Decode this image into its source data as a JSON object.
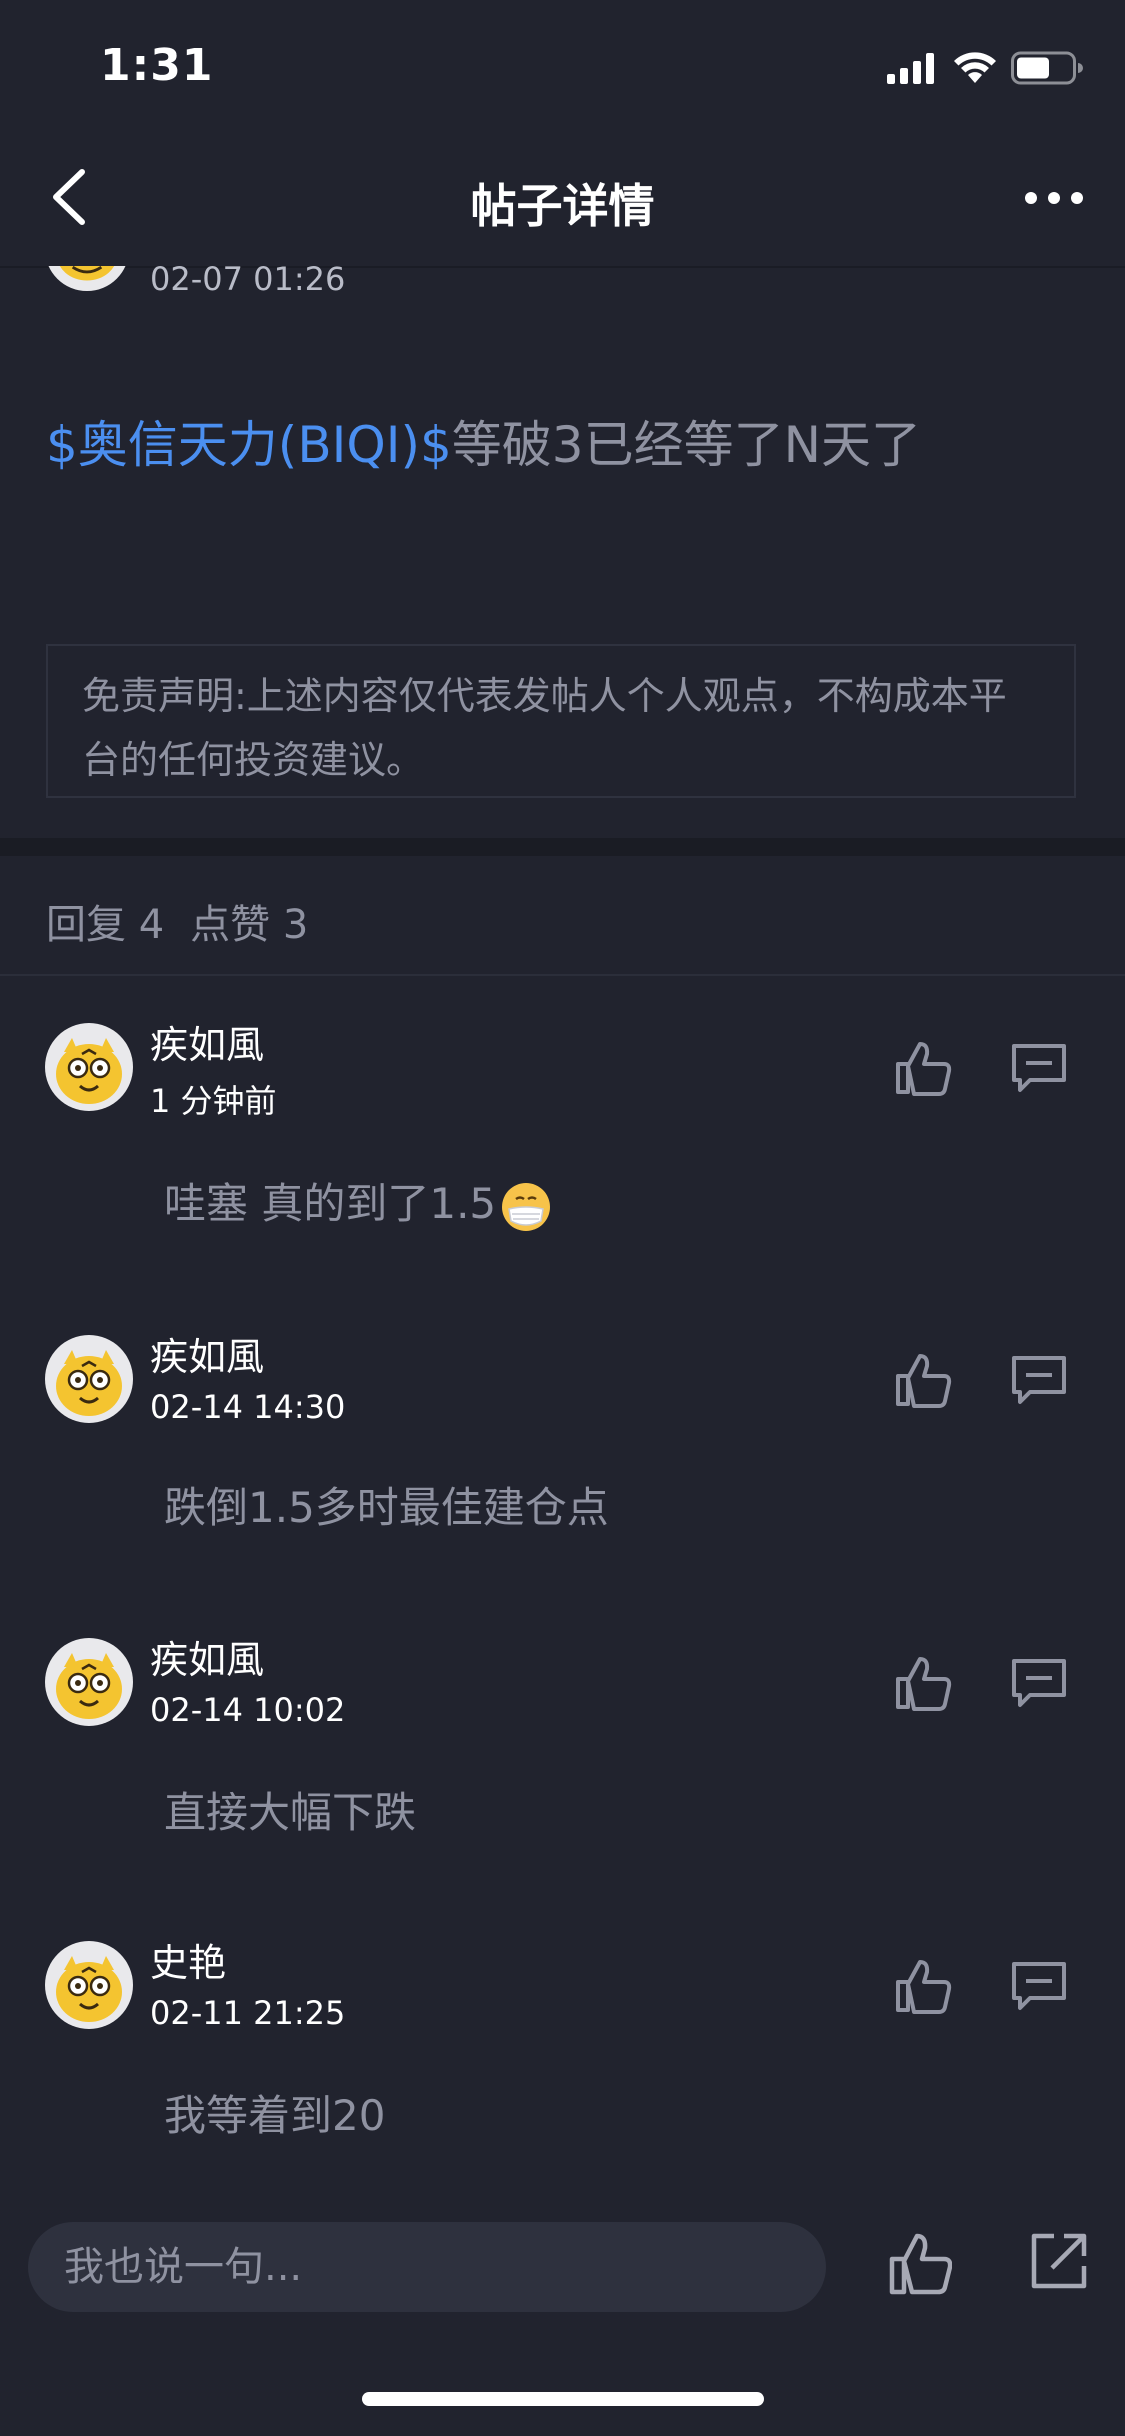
{
  "status_bar": {
    "time": "1:31"
  },
  "nav": {
    "title": "帖子详情"
  },
  "post": {
    "date": "02-07 01:26",
    "tag": "$奥信天力(BIQI)$",
    "text": "等破3已经等了N天了"
  },
  "disclaimer": "免责声明:上述内容仅代表发帖人个人观点，不构成本平台的任何投资建议。",
  "stats": {
    "replies": "回复 4",
    "likes": "点赞 3"
  },
  "comments": [
    {
      "name": "疾如風",
      "time": "1 分钟前",
      "text": "哇塞 真的到了1.5"
    },
    {
      "name": "疾如風",
      "time": "02-14 14:30",
      "text": "跌倒1.5多时最佳建仓点"
    },
    {
      "name": "疾如風",
      "time": "02-14 10:02",
      "text": "直接大幅下跌"
    },
    {
      "name": "史艳",
      "time": "02-11 21:25",
      "text": "我等着到20"
    }
  ],
  "composer": {
    "placeholder": "我也说一句..."
  },
  "colors": {
    "background": "#21232e",
    "accent": "#4b8ff0",
    "muted": "#8f92a1"
  }
}
